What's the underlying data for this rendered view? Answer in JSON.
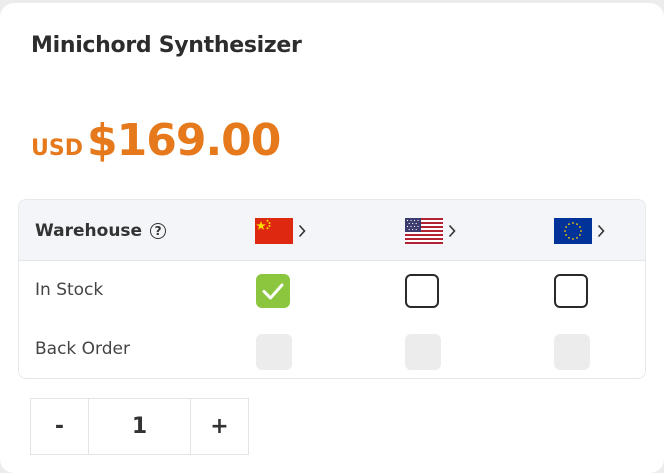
{
  "product": {
    "title": "Minichord Synthesizer",
    "currency": "USD",
    "price": "$169.00",
    "price_color": "#e5791b"
  },
  "table": {
    "header_label": "Warehouse",
    "help_icon": "question-circle-icon",
    "help_glyph": "?",
    "warehouses": [
      {
        "flag_icon": "china-flag-icon"
      },
      {
        "flag_icon": "usa-flag-icon"
      },
      {
        "flag_icon": "eu-flag-icon"
      }
    ],
    "in_stock_label": "In Stock",
    "back_order_label": "Back Order",
    "in_stock": [
      true,
      false,
      false
    ],
    "back_order": [
      false,
      false,
      false
    ],
    "checked_color": "#8cc63f"
  },
  "quantity": {
    "minus_label": "-",
    "value": "1",
    "plus_label": "+"
  }
}
